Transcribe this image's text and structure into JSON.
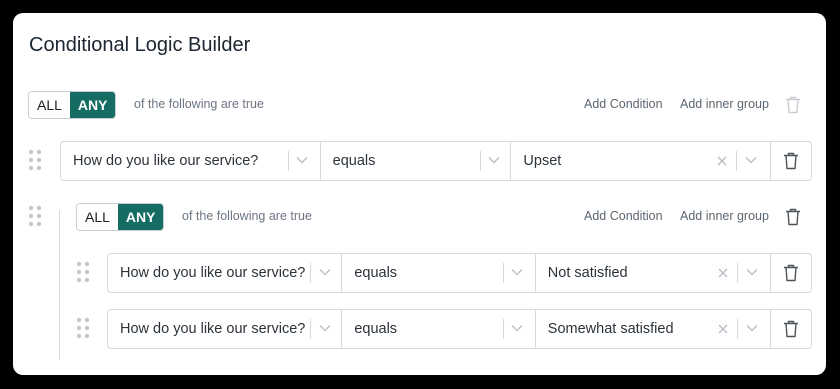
{
  "title": "Conditional Logic Builder",
  "group": {
    "all_label": "ALL",
    "any_label": "ANY",
    "qualifier": "of the following are true",
    "add_condition": "Add Condition",
    "add_inner_group": "Add inner group"
  },
  "condition": {
    "field": "How do you like our service?",
    "operator": "equals",
    "value": "Upset"
  },
  "inner_group": {
    "all_label": "ALL",
    "any_label": "ANY",
    "qualifier": "of the following are true",
    "add_condition": "Add Condition",
    "add_inner_group": "Add inner group",
    "conditions": [
      {
        "field": "How do you like our service?",
        "operator": "equals",
        "value": "Not satisfied"
      },
      {
        "field": "How do you like our service?",
        "operator": "equals",
        "value": "Somewhat satisfied"
      }
    ]
  },
  "colors": {
    "accent": "#146c62",
    "border": "#d5dae0"
  }
}
